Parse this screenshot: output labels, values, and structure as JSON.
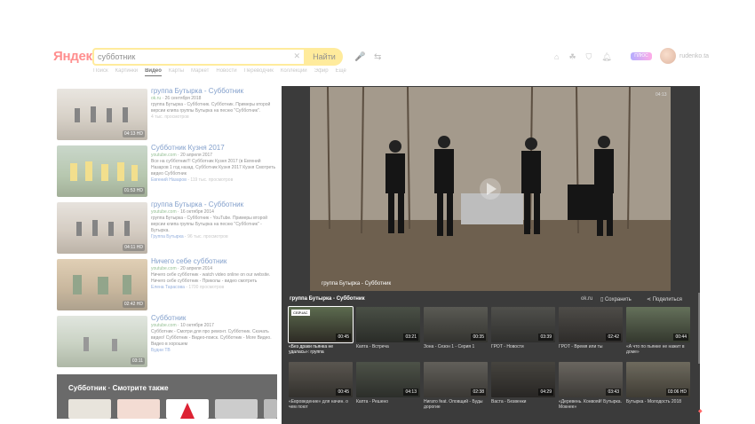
{
  "header": {
    "logo": "Яндекс",
    "search_value": "субботник",
    "search_button": "Найти",
    "plus_label": "ПЛЮС",
    "username": "rudenko.ta"
  },
  "tabs": [
    "Поиск",
    "Картинки",
    "Видео",
    "Карты",
    "Маркет",
    "Новости",
    "Переводчик",
    "Коллекции",
    "Эфир",
    "Ещё"
  ],
  "active_tab_index": 2,
  "results": [
    {
      "title": "группа Бутырка - Субботник",
      "source": "ok.ru",
      "date": "26 сентября 2018",
      "desc": "группа Бутырка - Субботник. Субботник. Примеры второй версии клипа группы Бутырка на песню \"Субботник\".",
      "views": "4 тыс. просмотров",
      "duration": "04:13 HD"
    },
    {
      "title": "Субботник Кузня 2017",
      "source": "youtube.com",
      "date": "20 апреля 2017",
      "desc": "Все на субботник!!! Субботник Кузня 2017 (в Евгений Назаров 1 год назад. Субботник Кузня 2017 Кузня Смотреть видео Субботник",
      "author": "Евгений Назаров",
      "views": "119 тыс. просмотров",
      "duration": "01:53 HD"
    },
    {
      "title": "группа Бутырка - Субботник",
      "source": "youtube.com",
      "date": "16 октября 2014",
      "desc": "группа Бутырка - Субботник - YouTube. Примеры второй версии клипа группы Бутырка на песню \"Субботник\" - Бутырка.",
      "author": "Группа Бутырка",
      "views": "96 тыс. просмотров",
      "duration": "04:11 HD"
    },
    {
      "title": "Ничего себе субботник",
      "source": "youtube.com",
      "date": "20 апреля 2014",
      "desc": "Ничего себе субботник - watch video online on our website. Ничего себе субботник - Приколы - видео смотреть",
      "author": "Елена Тарасова",
      "views": "1700 просмотров",
      "duration": "02:42 HD"
    },
    {
      "title": "Субботник",
      "source": "youtube.com",
      "date": "10 октября 2017",
      "desc": "Субботник - Смотри для про ремонт. Субботник. Скачать видео! Субботник - Видео-поиск. Субботник - More Видео. Видео в хорошем",
      "author": "Будни ТВ",
      "duration": "03:11"
    }
  ],
  "related": {
    "title": "Субботник · Смотрите также"
  },
  "player": {
    "time": "04:13",
    "overlay_title": "группа Бутырка - Субботник",
    "title": "группа Бутырка - Субботник",
    "source": "ok.ru",
    "save_label": "Сохранить",
    "share_label": "Поделиться",
    "now_playing": "СЕЙЧАС"
  },
  "grid": [
    {
      "caption": "«Без драки пьянка не удалась»: группа",
      "duration": "00:45",
      "selected": true
    },
    {
      "caption": "",
      "duration": "03:21"
    },
    {
      "caption": "Зона - Сезон 1 - Серия 1",
      "duration": "00:35"
    },
    {
      "caption": "ГРОТ - Новости",
      "duration": "03:39"
    },
    {
      "caption": "ГРОТ - Время или ты",
      "duration": "02:42"
    },
    {
      "caption": "«А что по пьянке не нажит в доме»",
      "duration": "00:44"
    },
    {
      "caption": "«Евроведение» для начин. о чем поют",
      "duration": "00:45"
    },
    {
      "caption": "Капта - Решено",
      "duration": "04:13"
    },
    {
      "caption": "Нигато feat. Оповщий - Буды дорогие",
      "duration": "02:38"
    },
    {
      "caption": "Васта - Безвенки",
      "duration": "04:29"
    },
    {
      "caption": "«Деревень. Конвояй! Бутырка. Мокнее»",
      "duration": "03:43"
    },
    {
      "caption": "Бутырка - Молодость 2018",
      "duration": "03:06 HD"
    }
  ],
  "grid_partial_captions": {
    "item2": "Капта - Встреча"
  }
}
